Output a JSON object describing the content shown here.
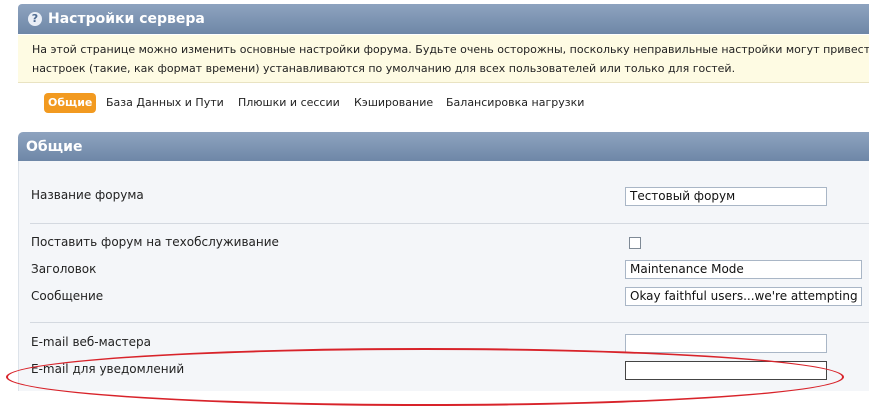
{
  "header": {
    "help_icon": "?",
    "title": "Настройки сервера"
  },
  "notice": {
    "line1": "На этой странице можно изменить основные настройки форума. Будьте очень осторожны, поскольку неправильные настройки могут привести",
    "line2": "настроек (такие, как формат времени) устанавливаются по умолчанию для всех пользователей или только для гостей."
  },
  "tabs": [
    {
      "label": "Общие",
      "active": true
    },
    {
      "label": "База Данных и Пути",
      "active": false
    },
    {
      "label": "Плюшки и сессии",
      "active": false
    },
    {
      "label": "Кэширование",
      "active": false
    },
    {
      "label": "Балансировка нагрузки",
      "active": false
    }
  ],
  "section": {
    "title": "Общие"
  },
  "settings": {
    "forum_name": {
      "label": "Название форума",
      "value": "Тестовый форум"
    },
    "maintenance": {
      "label": "Поставить форум на техобслуживание",
      "checked": false
    },
    "heading": {
      "label": "Заголовок",
      "value": "Maintenance Mode"
    },
    "message": {
      "label": "Сообщение",
      "value": "Okay faithful users...we're attempting"
    },
    "webmaster_email": {
      "label": "E-mail веб-мастера",
      "value": ""
    },
    "notify_email": {
      "label": "E-mail для уведомлений",
      "value": ""
    }
  },
  "colors": {
    "header_bar": "#7a91b0",
    "active_tab": "#f29a20",
    "notice_bg": "#fefbe3",
    "highlight": "#d8232a"
  }
}
